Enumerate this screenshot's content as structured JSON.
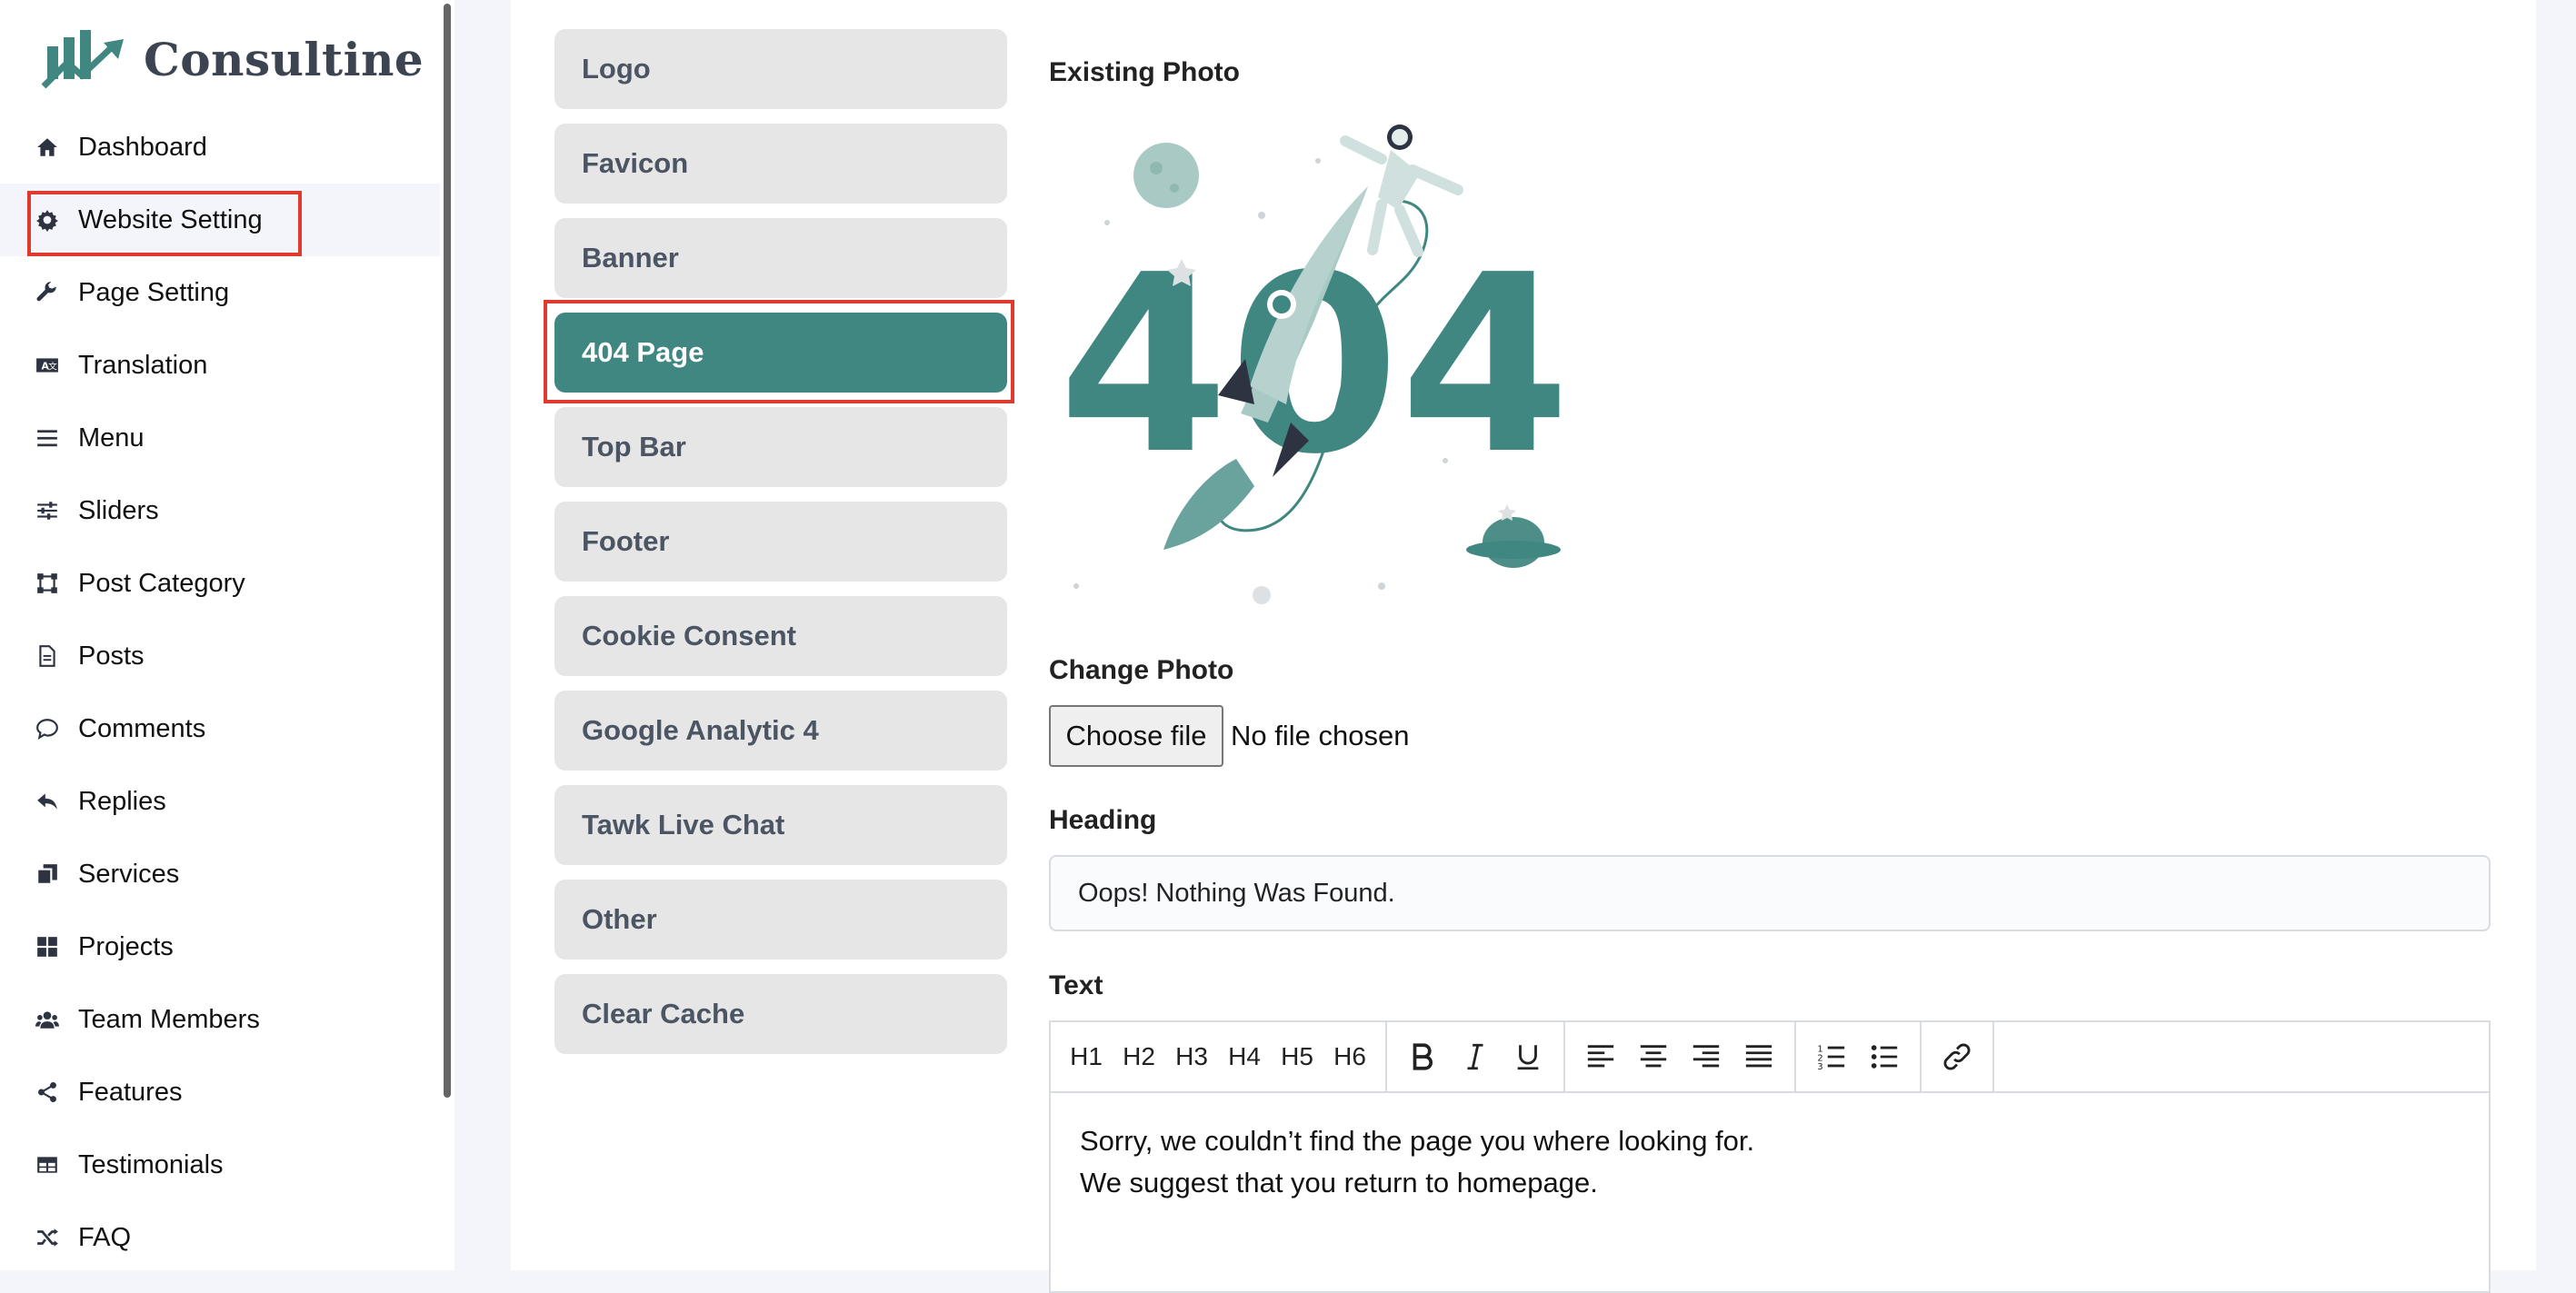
{
  "app": {
    "brand": "Consultine",
    "colors": {
      "accent": "#3f8780",
      "highlight": "#e03a2e"
    }
  },
  "sidebar": {
    "items": [
      {
        "label": "Dashboard",
        "icon": "home-icon"
      },
      {
        "label": "Website Setting",
        "icon": "gear-icon",
        "active": true
      },
      {
        "label": "Page Setting",
        "icon": "wrench-icon"
      },
      {
        "label": "Translation",
        "icon": "language-icon"
      },
      {
        "label": "Menu",
        "icon": "bars-icon"
      },
      {
        "label": "Sliders",
        "icon": "sliders-icon"
      },
      {
        "label": "Post Category",
        "icon": "vector-square-icon"
      },
      {
        "label": "Posts",
        "icon": "file-icon"
      },
      {
        "label": "Comments",
        "icon": "comment-icon"
      },
      {
        "label": "Replies",
        "icon": "reply-icon"
      },
      {
        "label": "Services",
        "icon": "copy-icon"
      },
      {
        "label": "Projects",
        "icon": "grid-icon"
      },
      {
        "label": "Team Members",
        "icon": "users-icon"
      },
      {
        "label": "Features",
        "icon": "share-icon"
      },
      {
        "label": "Testimonials",
        "icon": "table-icon"
      },
      {
        "label": "FAQ",
        "icon": "shuffle-icon"
      }
    ]
  },
  "tabs": [
    {
      "label": "Logo"
    },
    {
      "label": "Favicon"
    },
    {
      "label": "Banner"
    },
    {
      "label": "404 Page",
      "active": true
    },
    {
      "label": "Top Bar"
    },
    {
      "label": "Footer"
    },
    {
      "label": "Cookie Consent"
    },
    {
      "label": "Google Analytic 4"
    },
    {
      "label": "Tawk Live Chat"
    },
    {
      "label": "Other"
    },
    {
      "label": "Clear Cache"
    }
  ],
  "form": {
    "existing_photo_label": "Existing Photo",
    "illustration_text": "404",
    "change_photo_label": "Change Photo",
    "choose_file_label": "Choose file",
    "no_file_text": "No file chosen",
    "heading_label": "Heading",
    "heading_value": "Oops! Nothing Was Found.",
    "text_label": "Text",
    "toolbar": {
      "headings": [
        "H1",
        "H2",
        "H3",
        "H4",
        "H5",
        "H6"
      ]
    },
    "text_line1": "Sorry, we couldn’t find the page you where looking for.",
    "text_line2": "We suggest that you return to homepage."
  }
}
